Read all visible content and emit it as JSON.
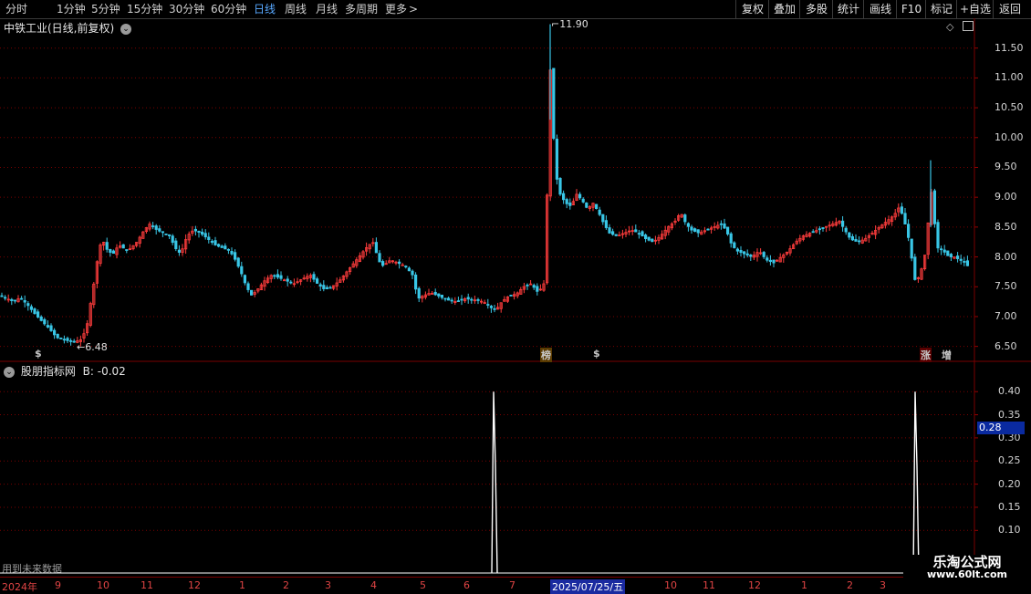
{
  "toolbar": {
    "periods": [
      "分时",
      "1分钟",
      "5分钟",
      "15分钟",
      "30分钟",
      "60分钟",
      "日线",
      "周线",
      "月线",
      "多周期",
      "更多"
    ],
    "active_period": "日线",
    "more_arrow": ">",
    "actions": [
      "复权",
      "叠加",
      "多股",
      "统计",
      "画线",
      "F10",
      "标记",
      "+自选",
      "返回"
    ]
  },
  "main_panel": {
    "title": "中铁工业(日线,前复权)",
    "dropdown_icon": "chevron-down-icon",
    "diamond_icon": "diamond-icon",
    "layout_icon": "layout-icon",
    "high_label": "11.90",
    "low_label": "6.48",
    "markers": [
      {
        "text": "$",
        "color": "#ff3030"
      },
      {
        "text": "榜",
        "color": "#ffcc00"
      },
      {
        "text": "$",
        "color": "#ff3030"
      },
      {
        "text": "涨",
        "color": "#ff3030"
      },
      {
        "text": "增",
        "color": "#ffffff"
      }
    ],
    "colors": {
      "up": "#ff3c3c",
      "down": "#39c6e6",
      "grid": "#7a0000",
      "text": "#d4d4d4"
    }
  },
  "indicator_panel": {
    "title": "股朋指标网",
    "value_label": "B: -0.02",
    "toggle_icon": "chevron-down-icon",
    "footer_note": "用到未来数据",
    "cursor_value": "0.28"
  },
  "date_axis": {
    "labels": [
      "2024年",
      "9",
      "10",
      "11",
      "12",
      "1",
      "2",
      "3",
      "4",
      "5",
      "6",
      "7",
      "2025/07/25/五",
      "10",
      "11",
      "12",
      "1",
      "2",
      "3"
    ]
  },
  "watermark": {
    "line1": "乐淘公式网",
    "line2": "www.60lt.com"
  },
  "chart_data": [
    {
      "type": "candlestick",
      "title": "中铁工业(日线,前复权)",
      "ylim": [
        6.25,
        12.0
      ],
      "y_ticks": [
        6.5,
        7.0,
        7.5,
        8.0,
        8.5,
        9.0,
        9.5,
        10.0,
        10.5,
        11.0,
        11.5
      ],
      "y_tick_labels": [
        "6.50",
        "7.00",
        "7.50",
        "8.00",
        "8.50",
        "9.00",
        "9.50",
        "10.00",
        "10.50",
        "11.00",
        "11.50"
      ],
      "grid": true,
      "close_path": [
        [
          0,
          7.35
        ],
        [
          8,
          7.3
        ],
        [
          15,
          7.25
        ],
        [
          22,
          7.32
        ],
        [
          30,
          7.2
        ],
        [
          38,
          7.05
        ],
        [
          46,
          6.92
        ],
        [
          54,
          6.8
        ],
        [
          62,
          6.65
        ],
        [
          72,
          6.6
        ],
        [
          82,
          6.58
        ],
        [
          90,
          6.62
        ],
        [
          96,
          6.9
        ],
        [
          100,
          7.3
        ],
        [
          104,
          7.65
        ],
        [
          108,
          8.1
        ],
        [
          112,
          8.3
        ],
        [
          118,
          8.1
        ],
        [
          124,
          8.05
        ],
        [
          130,
          8.2
        ],
        [
          140,
          8.1
        ],
        [
          150,
          8.25
        ],
        [
          158,
          8.45
        ],
        [
          164,
          8.55
        ],
        [
          172,
          8.45
        ],
        [
          180,
          8.4
        ],
        [
          186,
          8.35
        ],
        [
          192,
          8.15
        ],
        [
          198,
          8.05
        ],
        [
          205,
          8.35
        ],
        [
          212,
          8.45
        ],
        [
          220,
          8.4
        ],
        [
          228,
          8.3
        ],
        [
          236,
          8.2
        ],
        [
          244,
          8.15
        ],
        [
          252,
          8.1
        ],
        [
          258,
          7.95
        ],
        [
          264,
          7.75
        ],
        [
          270,
          7.5
        ],
        [
          276,
          7.35
        ],
        [
          282,
          7.45
        ],
        [
          290,
          7.6
        ],
        [
          298,
          7.7
        ],
        [
          306,
          7.65
        ],
        [
          314,
          7.6
        ],
        [
          322,
          7.55
        ],
        [
          330,
          7.62
        ],
        [
          340,
          7.7
        ],
        [
          348,
          7.55
        ],
        [
          356,
          7.45
        ],
        [
          364,
          7.5
        ],
        [
          372,
          7.6
        ],
        [
          380,
          7.75
        ],
        [
          388,
          7.9
        ],
        [
          396,
          8.05
        ],
        [
          404,
          8.2
        ],
        [
          410,
          8.25
        ],
        [
          414,
          7.95
        ],
        [
          420,
          7.85
        ],
        [
          428,
          7.95
        ],
        [
          436,
          7.9
        ],
        [
          444,
          7.85
        ],
        [
          452,
          7.7
        ],
        [
          458,
          7.3
        ],
        [
          464,
          7.35
        ],
        [
          472,
          7.4
        ],
        [
          480,
          7.35
        ],
        [
          490,
          7.28
        ],
        [
          500,
          7.25
        ],
        [
          510,
          7.3
        ],
        [
          520,
          7.28
        ],
        [
          530,
          7.25
        ],
        [
          538,
          7.15
        ],
        [
          544,
          7.12
        ],
        [
          550,
          7.25
        ],
        [
          558,
          7.35
        ],
        [
          566,
          7.38
        ],
        [
          574,
          7.5
        ],
        [
          582,
          7.55
        ],
        [
          590,
          7.4
        ],
        [
          596,
          7.55
        ],
        [
          600,
          9.2
        ],
        [
          603,
          11.2
        ],
        [
          606,
          10.2
        ],
        [
          609,
          9.4
        ],
        [
          614,
          9.05
        ],
        [
          620,
          8.9
        ],
        [
          626,
          8.85
        ],
        [
          632,
          9.05
        ],
        [
          638,
          8.95
        ],
        [
          644,
          8.8
        ],
        [
          650,
          8.9
        ],
        [
          656,
          8.75
        ],
        [
          662,
          8.55
        ],
        [
          668,
          8.4
        ],
        [
          676,
          8.35
        ],
        [
          684,
          8.4
        ],
        [
          692,
          8.45
        ],
        [
          700,
          8.4
        ],
        [
          708,
          8.3
        ],
        [
          716,
          8.25
        ],
        [
          724,
          8.35
        ],
        [
          732,
          8.5
        ],
        [
          740,
          8.6
        ],
        [
          746,
          8.75
        ],
        [
          752,
          8.55
        ],
        [
          758,
          8.45
        ],
        [
          766,
          8.4
        ],
        [
          774,
          8.45
        ],
        [
          782,
          8.5
        ],
        [
          790,
          8.55
        ],
        [
          796,
          8.45
        ],
        [
          802,
          8.2
        ],
        [
          808,
          8.1
        ],
        [
          816,
          8.05
        ],
        [
          824,
          8.0
        ],
        [
          832,
          8.1
        ],
        [
          840,
          7.95
        ],
        [
          848,
          7.9
        ],
        [
          856,
          8.0
        ],
        [
          864,
          8.1
        ],
        [
          872,
          8.25
        ],
        [
          880,
          8.35
        ],
        [
          888,
          8.4
        ],
        [
          896,
          8.45
        ],
        [
          904,
          8.5
        ],
        [
          912,
          8.55
        ],
        [
          920,
          8.6
        ],
        [
          926,
          8.45
        ],
        [
          932,
          8.3
        ],
        [
          940,
          8.25
        ],
        [
          948,
          8.3
        ],
        [
          956,
          8.4
        ],
        [
          964,
          8.5
        ],
        [
          972,
          8.6
        ],
        [
          980,
          8.7
        ],
        [
          986,
          8.85
        ],
        [
          992,
          8.55
        ],
        [
          996,
          8.3
        ],
        [
          1000,
          7.9
        ],
        [
          1004,
          7.5
        ],
        [
          1008,
          7.75
        ],
        [
          1012,
          7.85
        ],
        [
          1016,
          8.3
        ],
        [
          1020,
          9.2
        ],
        [
          1024,
          8.6
        ],
        [
          1028,
          8.15
        ],
        [
          1034,
          8.1
        ],
        [
          1040,
          8.0
        ],
        [
          1046,
          8.0
        ],
        [
          1052,
          7.95
        ],
        [
          1058,
          7.9
        ],
        [
          1063,
          7.8
        ]
      ],
      "annotations": [
        {
          "text": "11.90",
          "at": [
            604,
            11.9
          ]
        },
        {
          "text": "6.48",
          "at": [
            88,
            6.48
          ]
        }
      ]
    },
    {
      "type": "line",
      "title": "股朋指标网",
      "series_value_label": "B: -0.02",
      "ylim": [
        0,
        0.43
      ],
      "y_ticks": [
        0.1,
        0.15,
        0.2,
        0.25,
        0.3,
        0.35,
        0.4
      ],
      "y_tick_labels": [
        "0.10",
        "0.15",
        "0.20",
        "0.25",
        "0.30",
        "0.35",
        "0.40"
      ],
      "grid": true,
      "spikes": [
        {
          "x": 542,
          "value": 0.4
        },
        {
          "x": 1004,
          "value": 0.4
        }
      ],
      "baseline": 0.0
    }
  ]
}
